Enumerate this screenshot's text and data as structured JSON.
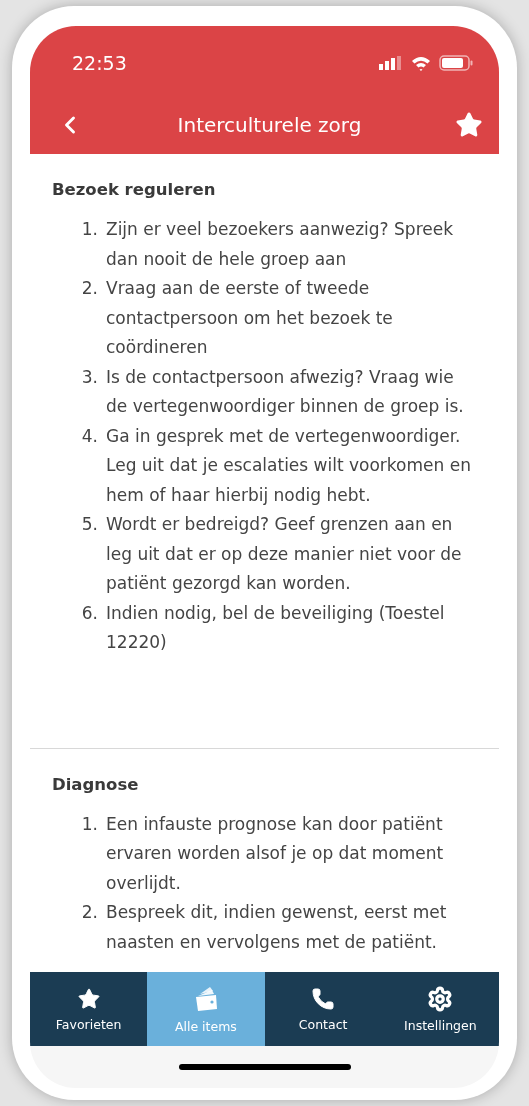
{
  "status_bar": {
    "time": "22:53"
  },
  "header": {
    "title": "Interculturele zorg",
    "favorite": true
  },
  "sections": [
    {
      "title": "Bezoek reguleren",
      "items": [
        {
          "number": "1.",
          "text": "Zijn er veel bezoekers aanwezig? Spreek dan nooit de hele groep aan"
        },
        {
          "number": "2.",
          "text": "Vraag aan de eerste of tweede contactpersoon om het bezoek te coördineren"
        },
        {
          "number": "3.",
          "text": "Is de contactpersoon afwezig? Vraag wie de vertegenwoordiger binnen de groep is."
        },
        {
          "number": "4.",
          "text": "Ga in gesprek met de vertegenwoordiger. Leg uit dat je escalaties wilt voorkomen en hem of haar hierbij nodig hebt."
        },
        {
          "number": "5.",
          "text": "Wordt er bedreigd? Geef grenzen aan en leg uit dat er op deze manier niet voor de patiënt gezorgd kan worden."
        },
        {
          "number": "6.",
          "text": "Indien nodig, bel de beveiliging (Toestel 12220)"
        }
      ]
    },
    {
      "title": "Diagnose",
      "items": [
        {
          "number": "1.",
          "text": "Een infauste prognose kan door patiënt ervaren worden alsof je op dat moment overlijdt."
        },
        {
          "number": "2.",
          "text": "Bespreek dit, indien gewenst, eerst met naasten en vervolgens met de patiënt."
        }
      ]
    }
  ],
  "tabs": [
    {
      "kind": "star",
      "label": "Favorieten",
      "selected": false
    },
    {
      "kind": "cards",
      "label": "Alle items",
      "selected": true
    },
    {
      "kind": "phone",
      "label": "Contact",
      "selected": false
    },
    {
      "kind": "gear",
      "label": "Instellingen",
      "selected": false
    }
  ]
}
